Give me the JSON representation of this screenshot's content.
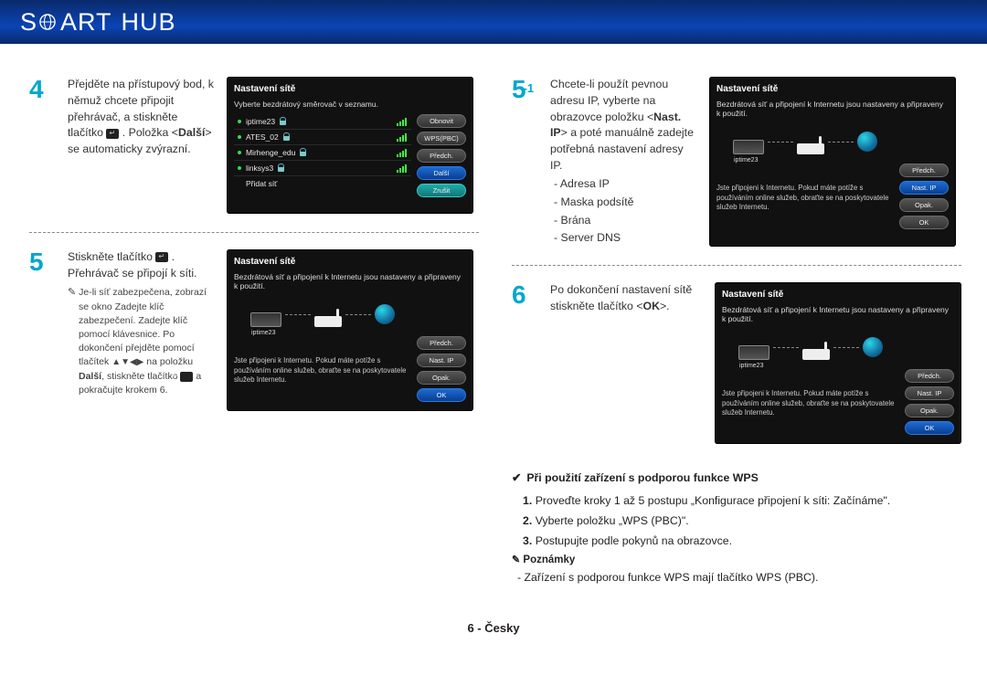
{
  "header": {
    "title_part1": "S",
    "title_part2": "ART",
    "title_part3": "HUB"
  },
  "steps": {
    "s4": {
      "num": "4",
      "text_1": "Přejděte na přístupový bod, k němuž chcete připojit přehrávač, a stiskněte tlačítko ",
      "text_2": ". Položka <",
      "bold": "Další",
      "text_3": "> se automaticky zvýrazní."
    },
    "s5": {
      "num": "5",
      "text_1": "Stiskněte tlačítko ",
      "text_2": ". Přehrávač se připojí k síti.",
      "note_1": "Je-li síť zabezpečena, zobrazí se okno Zadejte klíč zabezpečení. Zadejte klíč pomocí klávesnice. Po dokončení přejděte pomocí tlačítek ",
      "arrows": "▲▼◀▶",
      "note_2": " na položku ",
      "note_bold": "Další",
      "note_3": ", stiskněte tlačítko ",
      "note_4": " a pokračujte krokem 6."
    },
    "s5_1": {
      "num": "5",
      "sub": "-1",
      "text_1": "Chcete-li použít pevnou adresu IP, vyberte na obrazovce položku <",
      "bold": "Nast. IP",
      "text_2": "> a poté manuálně zadejte potřebná nastavení adresy IP.",
      "items": [
        "Adresa IP",
        "Maska podsítě",
        "Brána",
        "Server DNS"
      ]
    },
    "s6": {
      "num": "6",
      "text": "Po dokončení nastavení sítě stiskněte tlačítko <",
      "bold": "OK",
      "text_2": ">."
    }
  },
  "panel4": {
    "title": "Nastavení sítě",
    "subtitle": "Vyberte bezdrátový směrovač v seznamu.",
    "networks": [
      "iptime23",
      "ATES_02",
      "Mirhenge_edu",
      "linksys3",
      "Přidat síť"
    ],
    "buttons": [
      "Obnovit",
      "WPS(PBC)",
      "Předch.",
      "Další",
      "Zrušit"
    ]
  },
  "panel5": {
    "title": "Nastavení sítě",
    "subtitle": "Bezdrátová síť a připojení k Internetu jsou nastaveny a připraveny k použití.",
    "device_label": "iptime23",
    "buttons": [
      "Předch.",
      "Nast. IP",
      "Opak.",
      "OK"
    ],
    "footer": "Jste připojeni k Internetu. Pokud máte potíže s používáním online služeb, obraťte se na poskytovatele služeb Internetu."
  },
  "panel5_1": {
    "title": "Nastavení sítě",
    "subtitle": "Bezdrátová síť a připojení k Internetu jsou nastaveny a připraveny k použití.",
    "device_label": "iptime23",
    "buttons": [
      "Předch.",
      "Nast. IP",
      "Opak.",
      "OK"
    ],
    "footer": "Jste připojeni k Internetu. Pokud máte potíže s používáním online služeb, obraťte se na poskytovatele služeb Internetu."
  },
  "panel6": {
    "title": "Nastavení sítě",
    "subtitle": "Bezdrátová síť a připojení k Internetu jsou nastaveny a připraveny k použití.",
    "device_label": "iptime23",
    "buttons": [
      "Předch.",
      "Nast. IP",
      "Opak.",
      "OK"
    ],
    "footer": "Jste připojeni k Internetu. Pokud máte potíže s používáním online služeb, obraťte se na poskytovatele služeb Internetu."
  },
  "wps": {
    "title": "Při použití zařízení s podporou funkce WPS",
    "ol": [
      "Proveďte kroky 1 až 5 postupu „Konfigurace připojení k síti: Začínáme\".",
      "Vyberte položku „WPS (PBC)\".",
      "Postupujte podle pokynů na obrazovce."
    ],
    "notes_title": "Poznámky",
    "note": "Zařízení s podporou funkce WPS mají tlačítko WPS (PBC)."
  },
  "footer": "6 - Česky"
}
